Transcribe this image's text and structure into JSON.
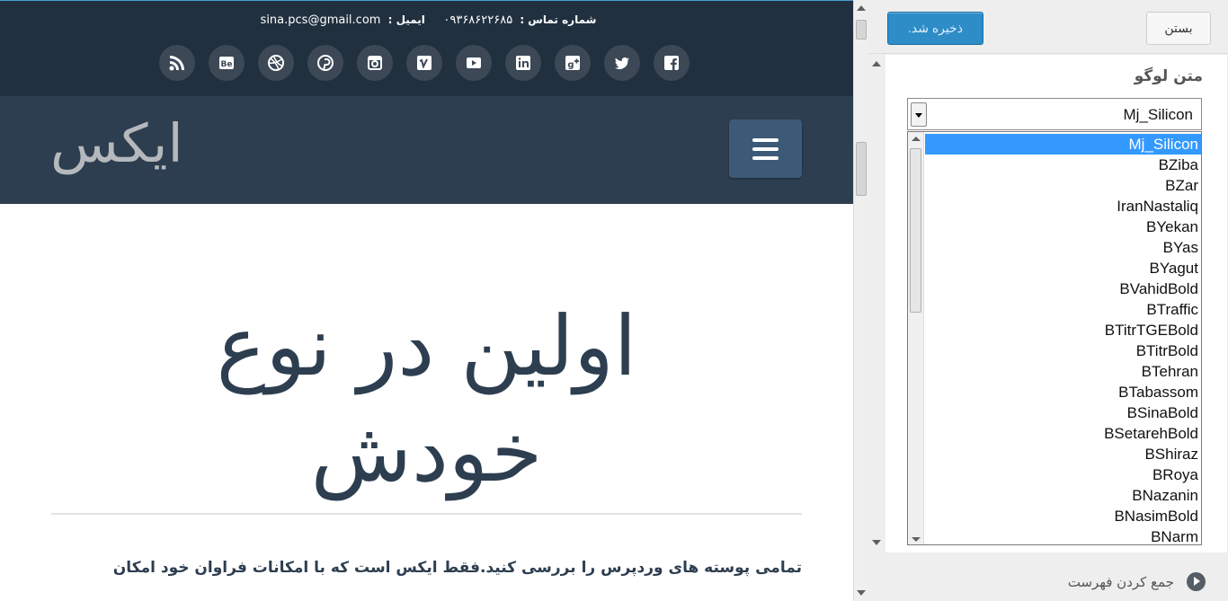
{
  "preview": {
    "contact_label": "شماره تماس :",
    "phone": "۰۹۳۶۸۶۲۲۶۸۵",
    "email_label": "ایمیل :",
    "email": "sina.pcs@gmail.com",
    "social_icons": [
      "facebook-icon",
      "twitter-icon",
      "google-plus-icon",
      "linkedin-icon",
      "youtube-icon",
      "vimeo-icon",
      "instagram-icon",
      "pinterest-icon",
      "dribbble-icon",
      "behance-icon",
      "rss-icon"
    ],
    "logo_text": "ایکس",
    "hero_line1": "اولین در نوع",
    "hero_line2": "خودش",
    "description": "تمامی پوسته های وردپرس را بررسی کنید.فقط ایکس است که با امکانات فراوان خود امکان",
    "colors": {
      "topbar": "#21303f",
      "navbar": "#2d3e50",
      "accent": "#2e8cc7"
    }
  },
  "panel": {
    "save_label": "ذخیره شد.",
    "close_label": "بستن",
    "section_title": "متن لوگو",
    "select_value": "Mj_Silicon",
    "options": [
      "Mj_Silicon",
      "BZiba",
      "BZar",
      "IranNastaliq",
      "BYekan",
      "BYas",
      "BYagut",
      "BVahidBold",
      "BTraffic",
      "BTitrTGEBold",
      "BTitrBold",
      "BTehran",
      "BTabassom",
      "BSinaBold",
      "BSetarehBold",
      "BShiraz",
      "BRoya",
      "BNazanin",
      "BNasimBold",
      "BNarm"
    ],
    "collapse_label": "جمع کردن فهرست"
  }
}
